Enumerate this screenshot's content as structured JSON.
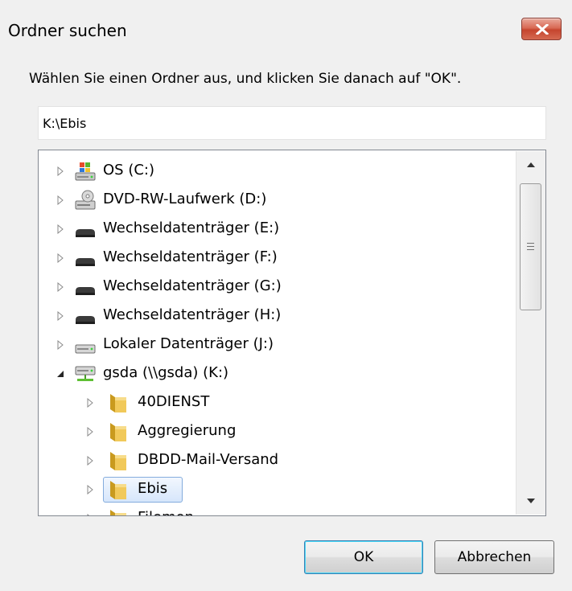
{
  "window": {
    "title": "Ordner suchen",
    "close_icon": "close-icon"
  },
  "prompt": "Wählen Sie einen Ordner aus, und klicken Sie danach auf \"OK\".",
  "path_field": {
    "value": "K:\\Ebis"
  },
  "tree": {
    "items": [
      {
        "label": "OS (C:)",
        "icon": "windows-drive-icon",
        "expanded": false
      },
      {
        "label": "DVD-RW-Laufwerk (D:)",
        "icon": "dvd-drive-icon",
        "expanded": false
      },
      {
        "label": "Wechseldatenträger (E:)",
        "icon": "removable-drive-icon",
        "expanded": false
      },
      {
        "label": "Wechseldatenträger (F:)",
        "icon": "removable-drive-icon",
        "expanded": false
      },
      {
        "label": "Wechseldatenträger (G:)",
        "icon": "removable-drive-icon",
        "expanded": false
      },
      {
        "label": "Wechseldatenträger (H:)",
        "icon": "removable-drive-icon",
        "expanded": false
      },
      {
        "label": "Lokaler Datenträger (J:)",
        "icon": "local-drive-icon",
        "expanded": false
      },
      {
        "label": "gsda (\\\\gsda) (K:)",
        "icon": "network-drive-icon",
        "expanded": true
      },
      {
        "label": "40DIENST",
        "icon": "folder-icon",
        "expanded": false
      },
      {
        "label": "Aggregierung",
        "icon": "folder-icon",
        "expanded": false
      },
      {
        "label": "DBDD-Mail-Versand",
        "icon": "folder-icon",
        "expanded": false
      },
      {
        "label": "Ebis",
        "icon": "folder-icon",
        "expanded": false,
        "selected": true
      },
      {
        "label": "Filemon",
        "icon": "folder-icon",
        "expanded": false
      }
    ]
  },
  "buttons": {
    "ok": "OK",
    "cancel": "Abbrechen"
  },
  "colors": {
    "close_button": "#c5452e",
    "selection": "#d6e6fb",
    "folder": "#e8b931"
  }
}
